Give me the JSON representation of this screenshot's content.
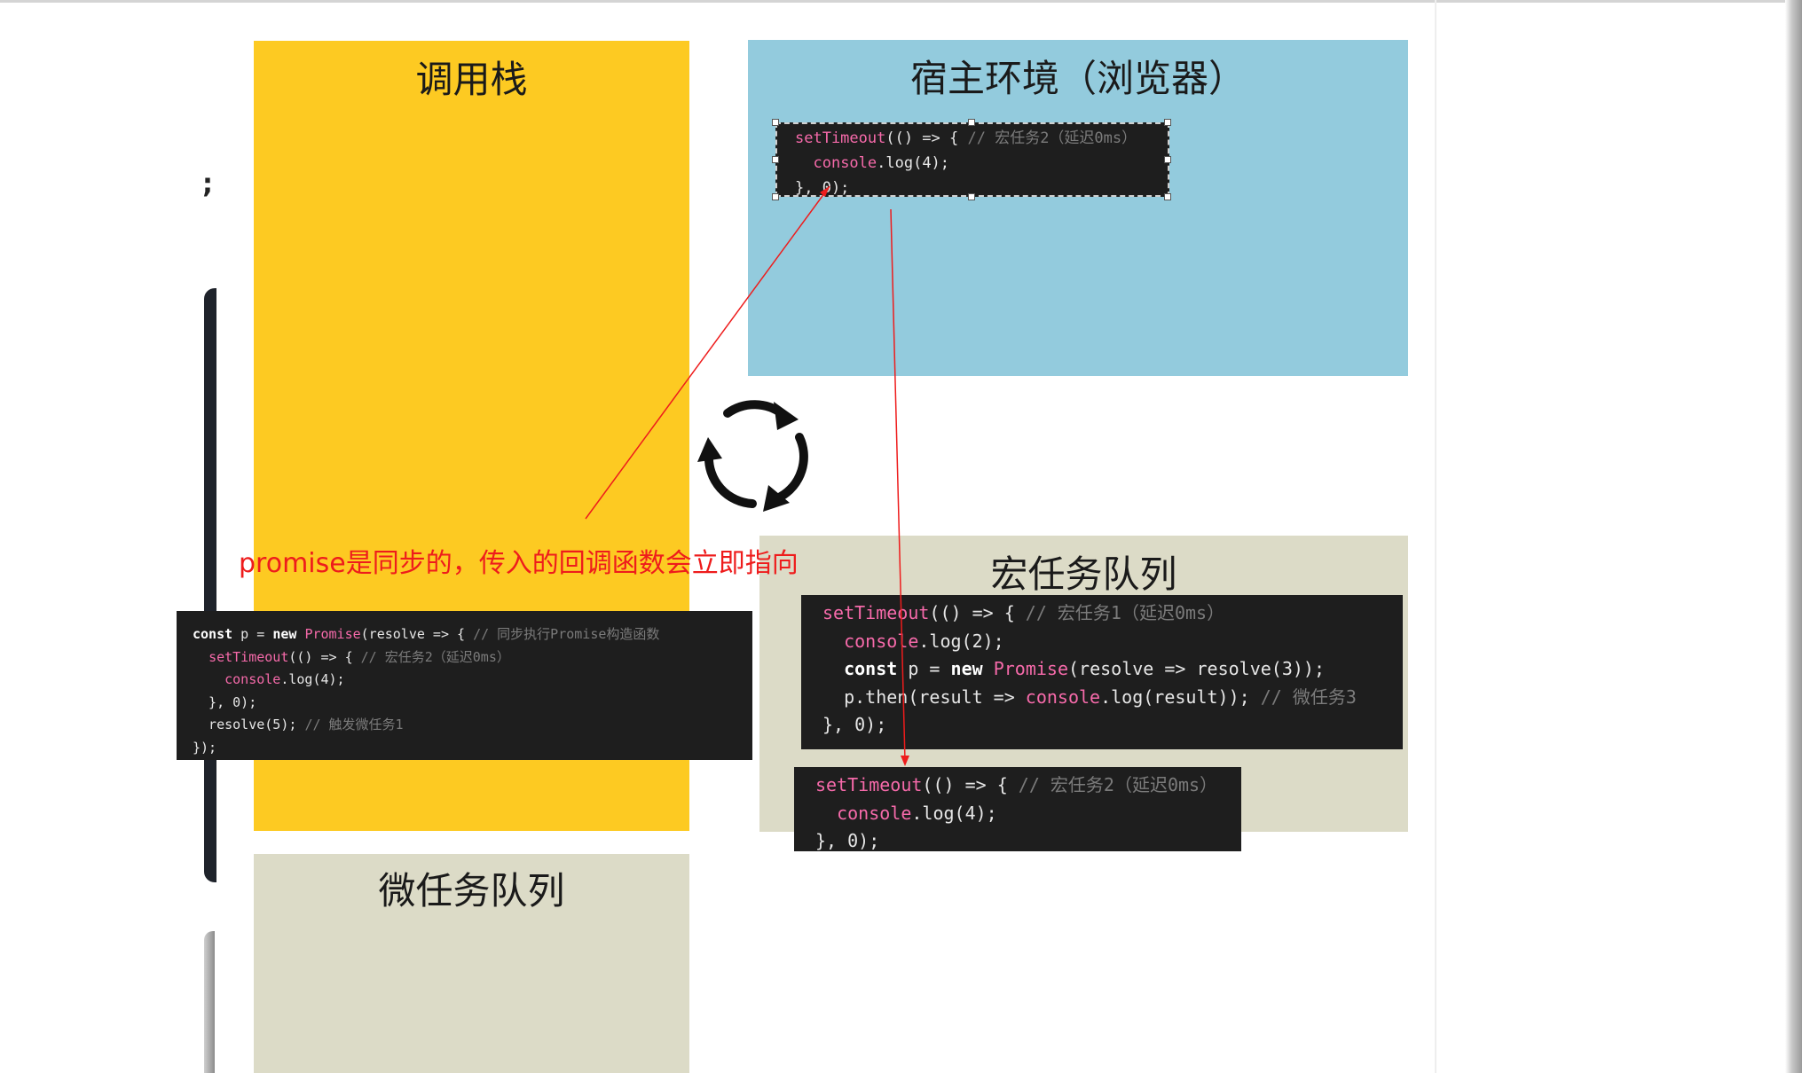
{
  "panels": {
    "call_stack": "调用栈",
    "host_environment": "宿主环境（浏览器）",
    "macrotask_queue": "宏任务队列",
    "microtask_queue": "微任务队列"
  },
  "annotation": "promise是同步的，传入的回调函数会立即指向",
  "left_glyph": ";",
  "icons": {
    "event_loop": "cycle-arrows-icon"
  },
  "colors": {
    "call_stack_bg": "#fdca22",
    "host_bg": "#93cbdd",
    "queue_bg": "#dcdbc7",
    "code_bg": "#1e1e1e",
    "annotation": "#ee1c1c"
  },
  "code_host": [
    [
      {
        "t": "setTimeout",
        "c": "fn"
      },
      {
        "t": "(() => { ",
        "c": "pl"
      },
      {
        "t": "// 宏任务2（延迟0ms）",
        "c": "cm"
      }
    ],
    [
      {
        "t": "  ",
        "c": "pl"
      },
      {
        "t": "console",
        "c": "fn"
      },
      {
        "t": ".log(4);",
        "c": "pl"
      }
    ],
    [
      {
        "t": "}, 0);",
        "c": "pl"
      }
    ]
  ],
  "code_call_stack": [
    [
      {
        "t": "const",
        "c": "kw"
      },
      {
        "t": " p = ",
        "c": "pl"
      },
      {
        "t": "new",
        "c": "kw"
      },
      {
        "t": " ",
        "c": "pl"
      },
      {
        "t": "Promise",
        "c": "fn"
      },
      {
        "t": "(resolve => { ",
        "c": "pl"
      },
      {
        "t": "// 同步执行Promise构造函数",
        "c": "cm"
      }
    ],
    [
      {
        "t": "  ",
        "c": "pl"
      },
      {
        "t": "setTimeout",
        "c": "fn"
      },
      {
        "t": "(() => { ",
        "c": "pl"
      },
      {
        "t": "// 宏任务2（延迟0ms）",
        "c": "cm"
      }
    ],
    [
      {
        "t": "    ",
        "c": "pl"
      },
      {
        "t": "console",
        "c": "fn"
      },
      {
        "t": ".log(4);",
        "c": "pl"
      }
    ],
    [
      {
        "t": "  }, 0);",
        "c": "pl"
      }
    ],
    [
      {
        "t": "  resolve(5); ",
        "c": "pl"
      },
      {
        "t": "// 触发微任务1",
        "c": "cm"
      }
    ],
    [
      {
        "t": "});",
        "c": "pl"
      }
    ]
  ],
  "code_macro_1": [
    [
      {
        "t": "setTimeout",
        "c": "fn"
      },
      {
        "t": "(() => { ",
        "c": "pl"
      },
      {
        "t": "// 宏任务1（延迟0ms）",
        "c": "cm"
      }
    ],
    [
      {
        "t": "  ",
        "c": "pl"
      },
      {
        "t": "console",
        "c": "fn"
      },
      {
        "t": ".log(2);",
        "c": "pl"
      }
    ],
    [
      {
        "t": "  ",
        "c": "pl"
      },
      {
        "t": "const",
        "c": "kw"
      },
      {
        "t": " p = ",
        "c": "pl"
      },
      {
        "t": "new",
        "c": "kw"
      },
      {
        "t": " ",
        "c": "pl"
      },
      {
        "t": "Promise",
        "c": "fn"
      },
      {
        "t": "(resolve => resolve(3));",
        "c": "pl"
      }
    ],
    [
      {
        "t": "  p.then(result => ",
        "c": "pl"
      },
      {
        "t": "console",
        "c": "fn"
      },
      {
        "t": ".log(result)); ",
        "c": "pl"
      },
      {
        "t": "// 微任务3",
        "c": "cm"
      }
    ],
    [
      {
        "t": "}, 0);",
        "c": "pl"
      }
    ]
  ],
  "code_macro_2": [
    [
      {
        "t": "setTimeout",
        "c": "fn"
      },
      {
        "t": "(() => { ",
        "c": "pl"
      },
      {
        "t": "// 宏任务2（延迟0ms）",
        "c": "cm"
      }
    ],
    [
      {
        "t": "  ",
        "c": "pl"
      },
      {
        "t": "console",
        "c": "fn"
      },
      {
        "t": ".log(4);",
        "c": "pl"
      }
    ],
    [
      {
        "t": "}, 0);",
        "c": "pl"
      }
    ]
  ]
}
